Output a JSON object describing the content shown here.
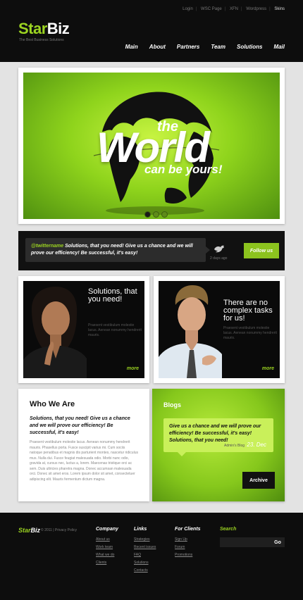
{
  "header": {
    "top_links": [
      "Login",
      "WSC Page",
      "XFN",
      "Wordpress",
      "Skins"
    ],
    "logo": {
      "part1": "Star",
      "part2": "Biz"
    },
    "tagline": "The Best Business Solutions",
    "nav": [
      "Main",
      "About",
      "Partners",
      "Team",
      "Solutions",
      "Mail"
    ]
  },
  "hero": {
    "the": "the",
    "headline": "World",
    "subline": "can be yours!",
    "slides_total": 3,
    "active_slide": 1
  },
  "twitter": {
    "handle": "@twittername",
    "message": "Solutions, that you need!  Give us a chance and we will prove our efficiency!  Be successful, it's easy!",
    "time": "2 days ago",
    "follow_label": "Follow us"
  },
  "cards": [
    {
      "title": "Solutions, that you need!",
      "text": "Praesent vestibulum molestie lacus. Aenean nonummy hendrerit mauris.",
      "more": "more"
    },
    {
      "title": "There are no complex tasks for us!",
      "text": "Praesent vestibulum molestie lacus. Aenean nonummy hendrerit mauris.",
      "more": "more"
    }
  ],
  "who": {
    "title": "Who We Are",
    "lead": "Solutions, that you need! Give us a chance and we will prove our efficiency! Be successful, it's easy!",
    "text": "Praesent vestibulum molestie lacus. Aenean nonummy hendrerit mauris. Phasellus porta. Fusce suscipit varius mi. Cum sociis natoque penatibus et magnis dis parturient montes, nascetur ridiculus mus. Nulla dui. Fusce feugiat malesuada odio. Morbi nunc odio, gravida at, cursus nec, luctus a, lorem. Maecenas tristique orci ac sem. Duis ultricies pharetra magna. Donec accumsan malesuada orci. Donec sit amet eros. Lorem ipsum dolor sit amet, consectetuer adipiscing elit. Mauris fermentum dictum magna."
  },
  "blog": {
    "title": "Blogs",
    "text": "Give us a chance and we will prove our efficiency!  Be successful, it's easy!  Solutions, that you need!",
    "author": "Admin's Blog",
    "date": "23. Dec",
    "archive_label": "Archive"
  },
  "footer": {
    "logo": {
      "part1": "Star",
      "part2": "Biz"
    },
    "copyright": "© 2011  |  Privacy Policy",
    "columns": [
      {
        "title": "Company",
        "links": [
          "About us",
          "Work team",
          "What we do",
          "Clients"
        ]
      },
      {
        "title": "Links",
        "links": [
          "Strategies",
          "Recent issues",
          "FAQ",
          "Solutions",
          "Contacts"
        ]
      },
      {
        "title": "For Clients",
        "links": [
          "Sign Up",
          "Forum",
          "Promotions"
        ]
      }
    ],
    "search": {
      "title": "Search",
      "placeholder": "",
      "button": "Go"
    }
  },
  "colors": {
    "accent": "#9bd321",
    "dark": "#0d0d0d",
    "background": "#e3e3e3"
  }
}
